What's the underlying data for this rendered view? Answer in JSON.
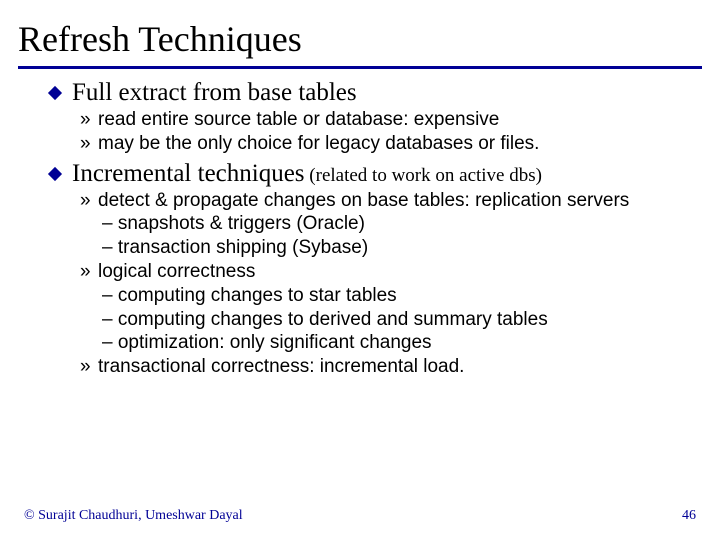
{
  "title": "Refresh Techniques",
  "items": [
    {
      "label": "Full extract from base tables",
      "paren": "",
      "subs": [
        {
          "text": "read entire source table or database: expensive",
          "subsubs": []
        },
        {
          "text": "may be the only choice for legacy databases or files.",
          "subsubs": []
        }
      ]
    },
    {
      "label": "Incremental techniques",
      "paren": " (related to work on active dbs)",
      "subs": [
        {
          "text": "detect & propagate changes on base tables: replication servers",
          "subsubs": [
            "– snapshots & triggers (Oracle)",
            "– transaction shipping (Sybase)"
          ]
        },
        {
          "text": "logical correctness",
          "subsubs": [
            "– computing changes to star tables",
            "– computing changes to derived and summary tables",
            "– optimization: only significant changes"
          ]
        },
        {
          "text": "transactional correctness: incremental load.",
          "subsubs": []
        }
      ]
    }
  ],
  "footer": {
    "left": "© Surajit Chaudhuri, Umeshwar Dayal",
    "right": "46"
  }
}
